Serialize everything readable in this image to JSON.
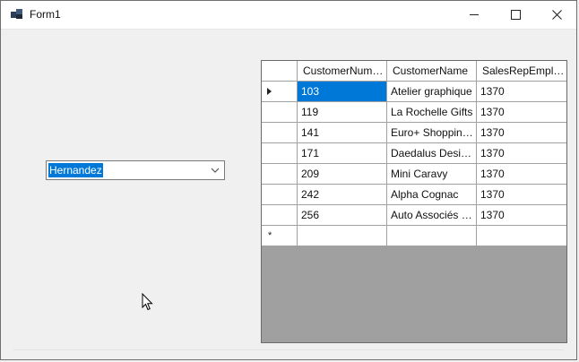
{
  "window": {
    "title": "Form1",
    "icon": "app-window-icon"
  },
  "combo": {
    "value": "Hernandez",
    "icon": "chevron-down-icon"
  },
  "grid": {
    "columns": [
      "CustomerNumber",
      "CustomerName",
      "SalesRepEmployeeNumber"
    ],
    "rows": [
      [
        "103",
        "Atelier graphique",
        "1370"
      ],
      [
        "119",
        "La Rochelle Gifts",
        "1370"
      ],
      [
        "141",
        "Euro+ Shopping Channel",
        "1370"
      ],
      [
        "171",
        "Daedalus Designs Imports",
        "1370"
      ],
      [
        "209",
        "Mini Caravy",
        "1370"
      ],
      [
        "242",
        "Alpha Cognac",
        "1370"
      ],
      [
        "256",
        "Auto Associés & Cie.",
        "1370"
      ]
    ],
    "new_row_marker": "*",
    "selected_row": 0
  },
  "colors": {
    "selection": "#0078d7",
    "grid_background": "#a0a0a0",
    "form_background": "#f0f0f0"
  }
}
